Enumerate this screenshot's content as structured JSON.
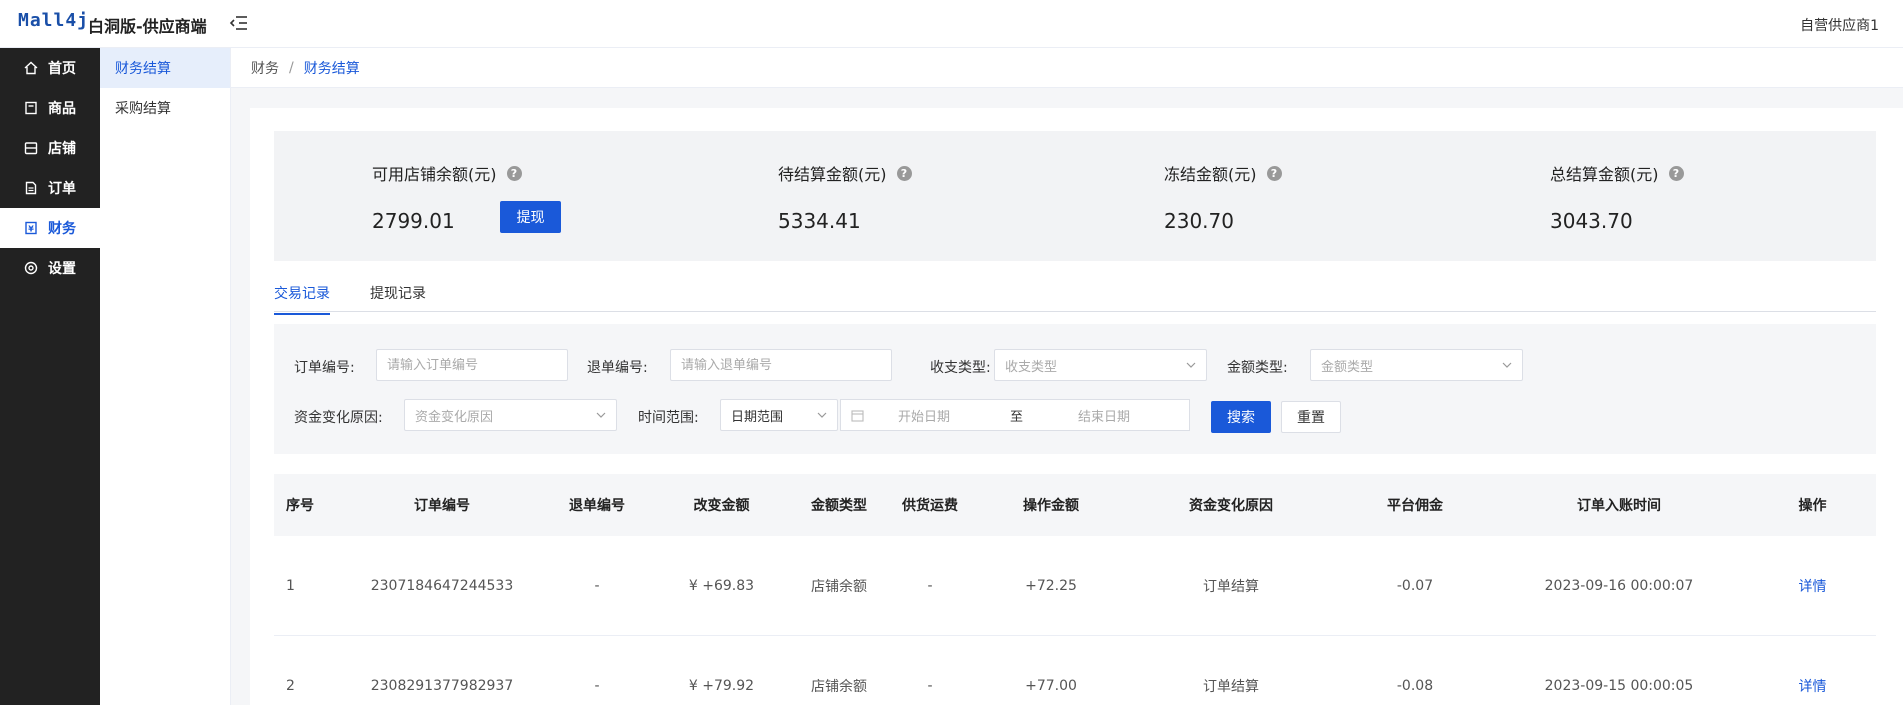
{
  "header": {
    "logo": "Mall4j",
    "title": "白洞版-供应商端",
    "user": "自营供应商1"
  },
  "sidebar": {
    "items": [
      {
        "label": "首页",
        "icon": "home-icon"
      },
      {
        "label": "商品",
        "icon": "goods-icon"
      },
      {
        "label": "店铺",
        "icon": "shop-icon"
      },
      {
        "label": "订单",
        "icon": "order-icon"
      },
      {
        "label": "财务",
        "icon": "finance-icon"
      },
      {
        "label": "设置",
        "icon": "gear-icon"
      }
    ],
    "active_index": 4
  },
  "subnav": {
    "items": [
      "财务结算",
      "采购结算"
    ],
    "active_index": 0
  },
  "breadcrumb": {
    "parent": "财务",
    "current": "财务结算"
  },
  "summary": {
    "available": {
      "label": "可用店铺余额(元)",
      "value": "2799.01"
    },
    "withdraw_label": "提现",
    "pending": {
      "label": "待结算金额(元)",
      "value": "5334.41"
    },
    "frozen": {
      "label": "冻结金额(元)",
      "value": "230.70"
    },
    "total": {
      "label": "总结算金额(元)",
      "value": "3043.70"
    }
  },
  "tabs": [
    "交易记录",
    "提现记录"
  ],
  "filters": {
    "order_no": {
      "label": "订单编号:",
      "placeholder": "请输入订单编号"
    },
    "refund_no": {
      "label": "退单编号:",
      "placeholder": "请输入退单编号"
    },
    "io_type": {
      "label": "收支类型:",
      "placeholder": "收支类型"
    },
    "amount_type": {
      "label": "金额类型:",
      "placeholder": "金额类型"
    },
    "reason": {
      "label": "资金变化原因:",
      "placeholder": "资金变化原因"
    },
    "time_range": {
      "label": "时间范围:",
      "selected": "日期范围",
      "start": "开始日期",
      "to": "至",
      "end": "结束日期"
    },
    "search_label": "搜索",
    "reset_label": "重置"
  },
  "table": {
    "headers": [
      "序号",
      "订单编号",
      "退单编号",
      "改变金额",
      "金额类型",
      "供货运费",
      "操作金额",
      "资金变化原因",
      "平台佣金",
      "订单入账时间",
      "操作"
    ],
    "rows": [
      [
        "1",
        "2307184647244533",
        "-",
        "¥ +69.83",
        "店铺余额",
        "-",
        "+72.25",
        "订单结算",
        "-0.07",
        "2023-09-16 00:00:07",
        "详情"
      ],
      [
        "2",
        "2308291377982937",
        "-",
        "¥ +79.92",
        "店铺余额",
        "-",
        "+77.00",
        "订单结算",
        "-0.08",
        "2023-09-15 00:00:05",
        "详情"
      ]
    ]
  },
  "colors": {
    "primary": "#1a59d9",
    "sidebar_bg": "#222222"
  }
}
